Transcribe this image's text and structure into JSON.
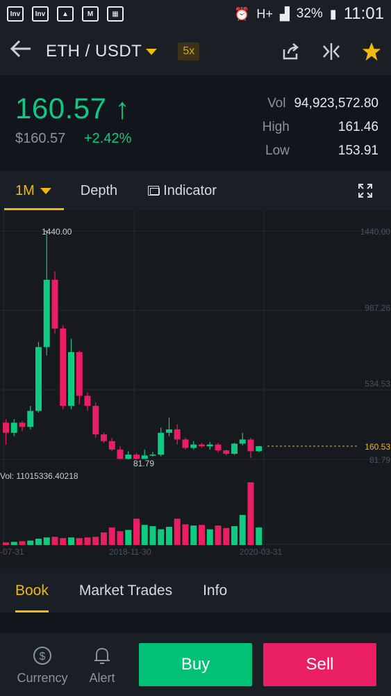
{
  "status_bar": {
    "battery": "32%",
    "time": "11:01",
    "network": "H+"
  },
  "header": {
    "pair": "ETH / USDT",
    "leverage": "5x"
  },
  "ticker": {
    "last_price": "160.57",
    "arrow": "↑",
    "fiat_price": "$160.57",
    "change": "+2.42%",
    "vol_label": "Vol",
    "vol": "94,923,572.80",
    "high_label": "High",
    "high": "161.46",
    "low_label": "Low",
    "low": "153.91"
  },
  "chart_tabs": {
    "interval": "1M",
    "depth": "Depth",
    "indicator": "Indicator"
  },
  "colors": {
    "up": "#0ecb81",
    "down": "#e91e63",
    "accent": "#f0b90b"
  },
  "chart_data": {
    "type": "candlestick",
    "y_ticks": [
      "1440.00",
      "987.26",
      "534.53",
      "81.79"
    ],
    "x_ticks": [
      "-07-31",
      "2018-11-30",
      "2020-03-31"
    ],
    "max_label": "1440.00",
    "min_label": "81.79",
    "current_price_label": "160.53",
    "volume_label": "Vol: 11015336.40218",
    "candles": [
      {
        "o": 300,
        "c": 240,
        "h": 320,
        "l": 170
      },
      {
        "o": 240,
        "c": 300,
        "h": 320,
        "l": 220
      },
      {
        "o": 300,
        "c": 275,
        "h": 310,
        "l": 250
      },
      {
        "o": 275,
        "c": 370,
        "h": 400,
        "l": 260
      },
      {
        "o": 370,
        "c": 750,
        "h": 780,
        "l": 360
      },
      {
        "o": 750,
        "c": 1150,
        "h": 1440,
        "l": 700
      },
      {
        "o": 1150,
        "c": 860,
        "h": 1200,
        "l": 830
      },
      {
        "o": 860,
        "c": 400,
        "h": 880,
        "l": 380
      },
      {
        "o": 400,
        "c": 720,
        "h": 800,
        "l": 380
      },
      {
        "o": 720,
        "c": 460,
        "h": 730,
        "l": 410
      },
      {
        "o": 460,
        "c": 400,
        "h": 480,
        "l": 370
      },
      {
        "o": 400,
        "c": 230,
        "h": 420,
        "l": 210
      },
      {
        "o": 230,
        "c": 190,
        "h": 240,
        "l": 180
      },
      {
        "o": 190,
        "c": 140,
        "h": 210,
        "l": 130
      },
      {
        "o": 140,
        "c": 85,
        "h": 160,
        "l": 82
      },
      {
        "o": 85,
        "c": 110,
        "h": 130,
        "l": 82
      },
      {
        "o": 110,
        "c": 85,
        "h": 120,
        "l": 82
      },
      {
        "o": 85,
        "c": 105,
        "h": 140,
        "l": 84
      },
      {
        "o": 105,
        "c": 110,
        "h": 125,
        "l": 98
      },
      {
        "o": 110,
        "c": 240,
        "h": 270,
        "l": 100
      },
      {
        "o": 240,
        "c": 260,
        "h": 330,
        "l": 220
      },
      {
        "o": 260,
        "c": 200,
        "h": 290,
        "l": 170
      },
      {
        "o": 200,
        "c": 150,
        "h": 210,
        "l": 140
      },
      {
        "o": 150,
        "c": 170,
        "h": 190,
        "l": 140
      },
      {
        "o": 170,
        "c": 160,
        "h": 180,
        "l": 150
      },
      {
        "o": 160,
        "c": 170,
        "h": 185,
        "l": 140
      },
      {
        "o": 170,
        "c": 135,
        "h": 180,
        "l": 125
      },
      {
        "o": 135,
        "c": 115,
        "h": 140,
        "l": 105
      },
      {
        "o": 115,
        "c": 175,
        "h": 180,
        "l": 108
      },
      {
        "o": 175,
        "c": 200,
        "h": 240,
        "l": 165
      },
      {
        "o": 200,
        "c": 130,
        "h": 210,
        "l": 90
      },
      {
        "o": 130,
        "c": 160,
        "h": 162,
        "l": 125
      }
    ],
    "volumes": [
      4,
      5,
      6,
      7,
      10,
      12,
      13,
      11,
      12,
      11,
      12,
      13,
      20,
      28,
      22,
      24,
      42,
      32,
      30,
      25,
      29,
      42,
      33,
      31,
      32,
      25,
      31,
      27,
      30,
      48,
      100,
      28
    ]
  },
  "bottom_tabs": {
    "book": "Book",
    "market_trades": "Market Trades",
    "info": "Info"
  },
  "bottom_bar": {
    "currency": "Currency",
    "alert": "Alert",
    "buy": "Buy",
    "sell": "Sell"
  }
}
